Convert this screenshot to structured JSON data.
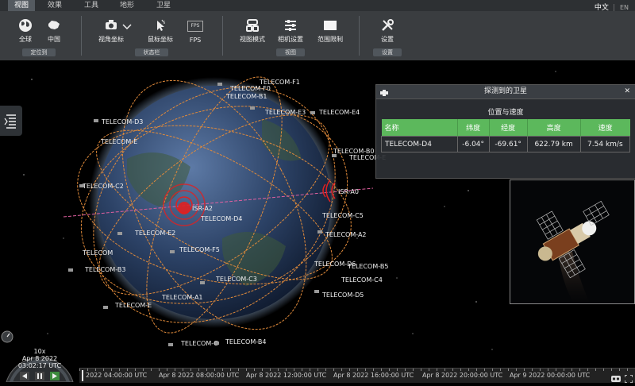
{
  "tabs": [
    "视图",
    "效果",
    "工具",
    "地形",
    "卫星"
  ],
  "lang": {
    "zh": "中文",
    "en": "EN"
  },
  "tools": [
    {
      "name": "globe-all",
      "label": "全球"
    },
    {
      "name": "china",
      "label": "中国"
    },
    {
      "name": "view-coord",
      "label": "视角坐标"
    },
    {
      "name": "mouse-coord",
      "label": "鼠标坐标"
    },
    {
      "name": "fps",
      "label": "FPS"
    },
    {
      "name": "view-mode",
      "label": "视图模式"
    },
    {
      "name": "camera-settings",
      "label": "相机设置"
    },
    {
      "name": "range-limit",
      "label": "范围限制"
    },
    {
      "name": "settings",
      "label": "设置"
    }
  ],
  "groups": [
    "定位到",
    "状态栏",
    "视图",
    "设置"
  ],
  "fps_icon_text": "FPS",
  "panel": {
    "title": "探测到的卫星",
    "subtitle": "位置与速度",
    "columns": [
      "名称",
      "纬度",
      "经度",
      "高度",
      "速度"
    ],
    "row": [
      "TELECOM-D4",
      "-6.04°",
      "-69.61°",
      "622.79 km",
      "7.54 km/s"
    ]
  },
  "satellites": [
    "TELECOM-F1",
    "TELECOM-F0",
    "TELECOM-B1",
    "TELECOM-D3",
    "TELECOM-E3",
    "TELECOM-E4",
    "TELECOM-C2",
    "TELECOM-B0",
    "TELECOM-E2",
    "TELECOM-D4",
    "TELECOM-C5",
    "TELECOM-A2",
    "TELECOM-F5",
    "TELECOM-B3",
    "TELECOM-C3",
    "TELECOM-D6",
    "TELECOM-B5",
    "TELECOM-C4",
    "TELECOM-A1",
    "TELECOM-D5",
    "TELECOM-B4",
    "TELECOM-E",
    "TELECOM-E",
    "TELECOM",
    "TELECOM-E",
    "TELECOM-C"
  ],
  "ground_stations": [
    "ISR-A2",
    "ISR-A0"
  ],
  "clock": {
    "speed": "10x",
    "date": "Apr 8 2022",
    "time": "03:02:17 UTC"
  },
  "timeline": [
    "2022 04:00:00 UTC",
    "Apr 8 2022 08:00:00 UTC",
    "Apr 8 2022 12:00:00 UTC",
    "Apr 8 2022 16:00:00 UTC",
    "Apr 8 2022 20:00:00 UTC",
    "Apr 9 2022 00:00:00 UTC"
  ],
  "colors": {
    "orbit": "#e08a3a",
    "accent_green": "#5cb85c",
    "station_red": "#e02020"
  }
}
